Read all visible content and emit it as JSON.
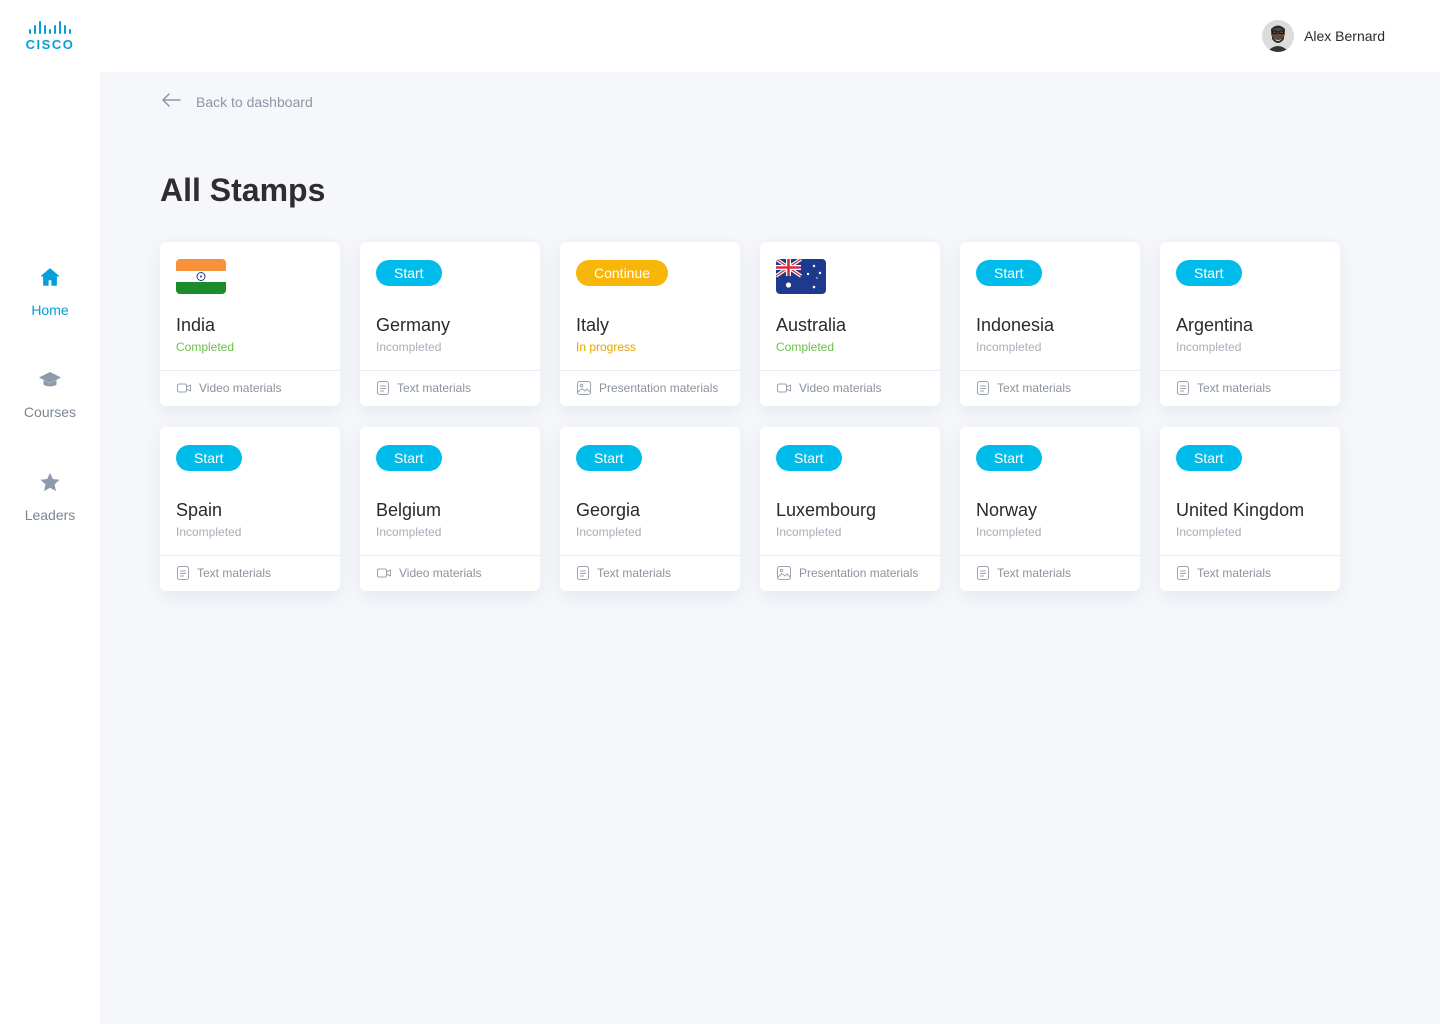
{
  "brand": {
    "logo_text": "CISCO"
  },
  "sidebar": {
    "items": [
      {
        "label": "Home",
        "icon": "home-icon",
        "active": true
      },
      {
        "label": "Courses",
        "icon": "graduation-cap-icon",
        "active": false
      },
      {
        "label": "Leaders",
        "icon": "star-icon",
        "active": false
      }
    ]
  },
  "header": {
    "user_name": "Alex Bernard"
  },
  "nav": {
    "back_label": "Back to dashboard"
  },
  "page": {
    "title": "All Stamps"
  },
  "colors": {
    "accent": "#049fd9",
    "start_badge": "#00bceb",
    "continue_badge": "#f8b60a",
    "completed": "#6cc04a",
    "in_progress": "#e6a500"
  },
  "stamps": [
    {
      "country": "India",
      "status": "Completed",
      "badge": null,
      "flag": "india",
      "material": "Video materials",
      "material_icon": "video-icon"
    },
    {
      "country": "Germany",
      "status": "Incompleted",
      "badge": "Start",
      "flag": null,
      "material": "Text materials",
      "material_icon": "document-icon"
    },
    {
      "country": "Italy",
      "status": "In progress",
      "badge": "Continue",
      "flag": null,
      "material": "Presentation materials",
      "material_icon": "image-icon"
    },
    {
      "country": "Australia",
      "status": "Completed",
      "badge": null,
      "flag": "australia",
      "material": "Video materials",
      "material_icon": "video-icon"
    },
    {
      "country": "Indonesia",
      "status": "Incompleted",
      "badge": "Start",
      "flag": null,
      "material": "Text materials",
      "material_icon": "document-icon"
    },
    {
      "country": "Argentina",
      "status": "Incompleted",
      "badge": "Start",
      "flag": null,
      "material": "Text materials",
      "material_icon": "document-icon"
    },
    {
      "country": "Spain",
      "status": "Incompleted",
      "badge": "Start",
      "flag": null,
      "material": "Text materials",
      "material_icon": "document-icon"
    },
    {
      "country": "Belgium",
      "status": "Incompleted",
      "badge": "Start",
      "flag": null,
      "material": "Video materials",
      "material_icon": "video-icon"
    },
    {
      "country": "Georgia",
      "status": "Incompleted",
      "badge": "Start",
      "flag": null,
      "material": "Text materials",
      "material_icon": "document-icon"
    },
    {
      "country": "Luxembourg",
      "status": "Incompleted",
      "badge": "Start",
      "flag": null,
      "material": "Presentation materials",
      "material_icon": "image-icon"
    },
    {
      "country": "Norway",
      "status": "Incompleted",
      "badge": "Start",
      "flag": null,
      "material": "Text materials",
      "material_icon": "document-icon"
    },
    {
      "country": "United Kingdom",
      "status": "Incompleted",
      "badge": "Start",
      "flag": null,
      "material": "Text materials",
      "material_icon": "document-icon"
    }
  ]
}
